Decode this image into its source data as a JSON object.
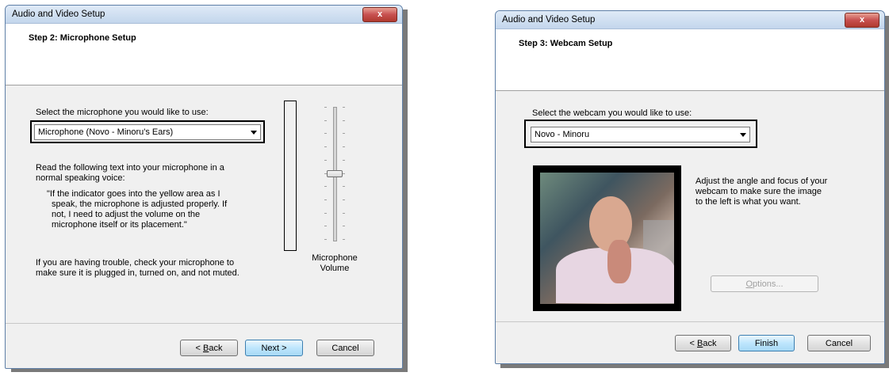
{
  "mic_dialog": {
    "window_title": "Audio and Video Setup",
    "close_label": "x",
    "step_title": "Step 2: Microphone Setup",
    "select_label": "Select the microphone you would like to use:",
    "selected_device": "Microphone (Novo - Minoru's Ears)",
    "instructions_line1": "Read the following text into your microphone in a",
    "instructions_line2": "normal speaking voice:",
    "quote_line1": "\"If the indicator goes into the yellow area as I",
    "quote_line2": "speak, the microphone is adjusted properly.  If",
    "quote_line3": "not, I need to adjust the volume on the",
    "quote_line4": "microphone itself or its placement.\"",
    "trouble_line1": "If you are having trouble, check your microphone to",
    "trouble_line2": "make sure it is plugged in, turned on, and not muted.",
    "volume_label_line1": "Microphone",
    "volume_label_line2": "Volume",
    "volume_level": 0.5,
    "back_prefix": "< ",
    "back_key": "B",
    "back_rest": "ack",
    "next_label": "Next >",
    "cancel_label": "Cancel"
  },
  "webcam_dialog": {
    "window_title": "Audio and Video Setup",
    "close_label": "x",
    "step_title": "Step 3: Webcam Setup",
    "select_label": "Select the webcam you would like to use:",
    "selected_device": "Novo - Minoru",
    "adjust_line1": "Adjust the angle and focus of your",
    "adjust_line2": "webcam to make sure the image",
    "adjust_line3": "to the left is what you want.",
    "options_key": "O",
    "options_rest": "ptions...",
    "back_prefix": "< ",
    "back_key": "B",
    "back_rest": "ack",
    "finish_label": "Finish",
    "cancel_label": "Cancel"
  }
}
